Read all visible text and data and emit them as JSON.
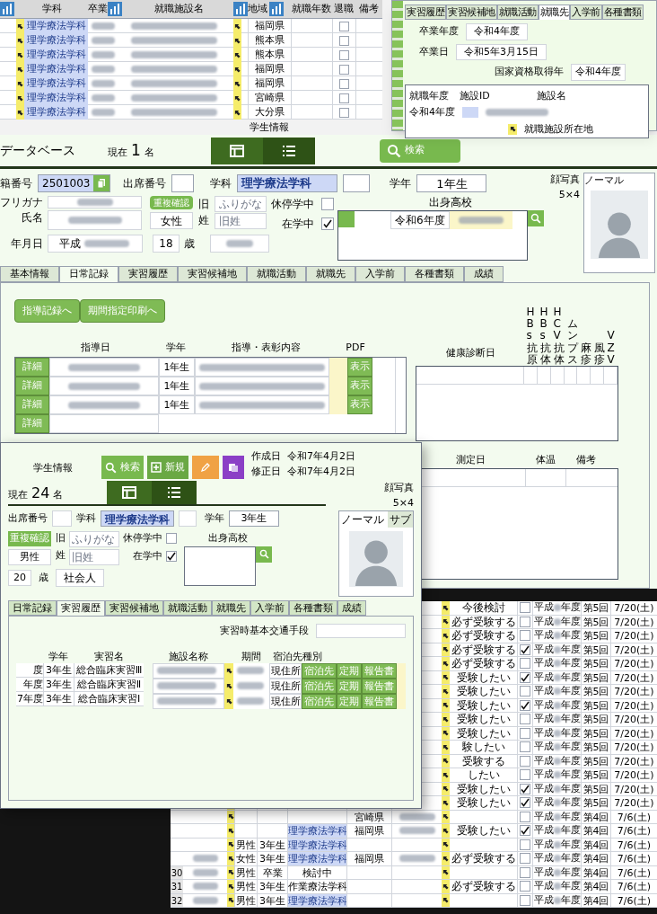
{
  "employment_table": {
    "columns": [
      "学科",
      "卒業",
      "就職施設名",
      "地域",
      "就職年数",
      "退職",
      "備考"
    ],
    "rows": [
      {
        "department": "理学療法学科",
        "region": "福岡県",
        "retired": false
      },
      {
        "department": "理学療法学科",
        "region": "熊本県",
        "retired": false
      },
      {
        "department": "理学療法学科",
        "region": "熊本県",
        "retired": false
      },
      {
        "department": "理学療法学科",
        "region": "福岡県",
        "retired": false
      },
      {
        "department": "理学療法学科",
        "region": "福岡県",
        "retired": false
      },
      {
        "department": "理学療法学科",
        "region": "宮崎県",
        "retired": false
      },
      {
        "department": "理学療法学科",
        "region": "大分県",
        "retired": false
      }
    ]
  },
  "employment_window": {
    "tabs": [
      {
        "label": "実習履歴",
        "selected": false
      },
      {
        "label": "実習候補地",
        "selected": false
      },
      {
        "label": "就職活動",
        "selected": false
      },
      {
        "label": "就職先",
        "selected": true
      },
      {
        "label": "入学前",
        "selected": false
      },
      {
        "label": "各種書類",
        "selected": false
      }
    ],
    "graduation_year_label": "卒業年度",
    "graduation_year": "令和4年度",
    "graduation_date_label": "卒業日",
    "graduation_date": "令和5年3月15日",
    "license_year_label": "国家資格取得年",
    "license_year": "令和4年度",
    "columns": [
      "就職年度",
      "施設ID",
      "施設名",
      "就職施設所在地"
    ],
    "row_year": "令和4年度"
  },
  "header": {
    "title": "学生情報",
    "app_name": "データベース",
    "count_prefix": "現在",
    "count": "1",
    "count_suffix": "名",
    "search_button": "検索"
  },
  "student": {
    "id_label": "籍番号",
    "id": "2501003",
    "attendance_label": "出席番号",
    "department_label": "学科",
    "department": "理学療法学科",
    "grade_label": "学年",
    "grade": "1年生",
    "school_label": "出身高校",
    "school_year": "令和6年度",
    "furigana_label": "フリガナ",
    "name_label": "氏名",
    "duplicate_button": "重複確認",
    "gender": "女性",
    "old_name_label_1": "旧",
    "old_name_label_2": "姓",
    "old_furigana_placeholder": "ふりがな",
    "old_name_placeholder": "旧姓",
    "suspended_label": "休停学中",
    "suspended": false,
    "enrolled_label": "在学中",
    "enrolled": true,
    "birth_label": "年月日",
    "birth_era": "平成",
    "age": "18",
    "age_unit": "歳",
    "photo_label": "顔写真",
    "photo_size": "5×4",
    "photo_tab": "ノーマル"
  },
  "tabs": [
    {
      "label": "基本情報",
      "selected": false
    },
    {
      "label": "日常記録",
      "selected": true
    },
    {
      "label": "実習履歴",
      "selected": false
    },
    {
      "label": "実習候補地",
      "selected": false
    },
    {
      "label": "就職活動",
      "selected": false
    },
    {
      "label": "就職先",
      "selected": false
    },
    {
      "label": "入学前",
      "selected": false
    },
    {
      "label": "各種書類",
      "selected": false
    },
    {
      "label": "成績",
      "selected": false
    }
  ],
  "actions": [
    "指導記録へ",
    "期間指定印刷へ"
  ],
  "guidance_table": {
    "columns": [
      "指導日",
      "学年",
      "指導・表彰内容",
      "PDF"
    ],
    "rows": [
      {
        "detail": "詳細",
        "grade": "1年生",
        "pdf": "表示",
        "filled": true
      },
      {
        "detail": "詳細",
        "grade": "1年生",
        "pdf": "表示",
        "filled": true
      },
      {
        "detail": "詳細",
        "grade": "1年生",
        "pdf": "表示",
        "filled": true
      },
      {
        "detail": "詳細",
        "filled": false
      }
    ]
  },
  "health_table": {
    "columns": [
      "健康診断日",
      "HBs抗原",
      "HBs抗体",
      "HCV抗体",
      "ムンプス",
      "麻疹",
      "風疹",
      "VZV"
    ]
  },
  "temperature_table": {
    "columns": [
      "測定日",
      "体温",
      "備考"
    ]
  },
  "exam_table": {
    "rows": [
      {
        "intent": "今後検討",
        "checked": false,
        "era": "平成",
        "year_suffix": "年度",
        "round": "第5回",
        "date": "7/20(土)"
      },
      {
        "intent": "必ず受験する",
        "checked": false,
        "era": "平成",
        "year_suffix": "年度",
        "round": "第5回",
        "date": "7/20(土)"
      },
      {
        "intent": "必ず受験する",
        "checked": false,
        "era": "平成",
        "year_suffix": "年度",
        "round": "第5回",
        "date": "7/20(土)"
      },
      {
        "intent": "必ず受験する",
        "checked": true,
        "era": "平成",
        "year_suffix": "年度",
        "round": "第5回",
        "date": "7/20(土)"
      },
      {
        "intent": "必ず受験する",
        "checked": false,
        "era": "平成",
        "year_suffix": "年度",
        "round": "第5回",
        "date": "7/20(土)"
      },
      {
        "intent": "受験したい",
        "checked": true,
        "era": "平成",
        "year_suffix": "年度",
        "round": "第5回",
        "date": "7/20(土)"
      },
      {
        "intent": "受験したい",
        "checked": false,
        "era": "平成",
        "year_suffix": "年度",
        "round": "第5回",
        "date": "7/20(土)"
      },
      {
        "intent": "受験したい",
        "checked": true,
        "era": "平成",
        "year_suffix": "年度",
        "round": "第5回",
        "date": "7/20(土)"
      },
      {
        "intent": "受験したい",
        "checked": false,
        "era": "平成",
        "year_suffix": "年度",
        "round": "第5回",
        "date": "7/20(土)"
      },
      {
        "intent": "受験したい",
        "checked": false,
        "era": "平成",
        "year_suffix": "年度",
        "round": "第5回",
        "date": "7/20(土)"
      },
      {
        "intent": "験したい",
        "checked": false,
        "era": "平成",
        "year_suffix": "年度",
        "round": "第5回",
        "date": "7/20(土)"
      },
      {
        "intent": "受験する",
        "checked": false,
        "era": "平成",
        "year_suffix": "年度",
        "round": "第5回",
        "date": "7/20(土)"
      },
      {
        "intent": "したい",
        "checked": false,
        "era": "平成",
        "year_suffix": "年度",
        "round": "第5回",
        "date": "7/20(土)"
      },
      {
        "intent": "受験したい",
        "checked": true,
        "era": "平成",
        "year_suffix": "年度",
        "round": "第5回",
        "date": "7/20(土)"
      },
      {
        "intent": "受験したい",
        "checked": true,
        "era": "平成",
        "year_suffix": "年度",
        "round": "第5回",
        "date": "7/20(土)"
      },
      {
        "region": "宮崎県",
        "school": true,
        "checked": false,
        "era": "平成",
        "year_suffix": "年度",
        "round": "第4回",
        "date": "7/6(土)"
      },
      {
        "department": "理学療法学科",
        "department_highlight": true,
        "region": "福岡県",
        "school": true,
        "intent": "受験したい",
        "checked": true,
        "era": "平成",
        "year_suffix": "年度",
        "round": "第4回",
        "date": "7/6(土)"
      },
      {
        "gender": "男性",
        "grade": "3年生",
        "department": "理学療法学科",
        "department_highlight": true,
        "checked": false,
        "era": "平成",
        "year_suffix": "年度",
        "round": "第4回",
        "date": "7/6(土)"
      },
      {
        "name": true,
        "gender": "女性",
        "grade": "3年生",
        "department": "理学療法学科",
        "department_highlight": true,
        "region": "福岡県",
        "school": true,
        "intent": "必ず受験する",
        "checked": false,
        "era": "平成",
        "year_suffix": "年度",
        "round": "第4回",
        "date": "7/6(土)"
      },
      {
        "number": "30",
        "name": true,
        "gender": "男性",
        "grade": "卒業",
        "department": "検討中",
        "department_highlight": false,
        "checked": false,
        "era": "平成",
        "year_suffix": "年度",
        "round": "第4回",
        "date": "7/6(土)"
      },
      {
        "number": "31",
        "name": true,
        "gender": "男性",
        "grade": "3年生",
        "department": "作業療法学科",
        "department_highlight": false,
        "intent": "必ず受験する",
        "checked": false,
        "era": "平成",
        "year_suffix": "年度",
        "round": "第4回",
        "date": "7/6(土)"
      },
      {
        "number": "32",
        "name": true,
        "gender": "男性",
        "grade": "3年生",
        "department": "理学療法学科",
        "department_highlight": true,
        "checked": false,
        "era": "平成",
        "year_suffix": "年度",
        "round": "第4回",
        "date": "7/6(土)"
      }
    ]
  },
  "overlay_window": {
    "title": "学生情報",
    "count_prefix": "現在",
    "count": "24",
    "count_suffix": "名",
    "search_button": "検索",
    "new_button": "新規",
    "created_label": "作成日",
    "created": "令和7年4月2日",
    "modified_label": "修正日",
    "modified": "令和7年4月2日",
    "attendance_label": "出席番号",
    "department_label": "学科",
    "department": "理学療法学科",
    "grade_label": "学年",
    "grade": "3年生",
    "school_label": "出身高校",
    "photo_label": "顔写真",
    "photo_size": "5×4",
    "photo_tabs": [
      {
        "label": "ノーマル",
        "selected": true
      },
      {
        "label": "サブ",
        "selected": false
      }
    ],
    "duplicate_button": "重複確認",
    "gender": "男性",
    "old_name_label_1": "旧",
    "old_name_label_2": "姓",
    "old_furigana_placeholder": "ふりがな",
    "old_name_placeholder": "旧姓",
    "suspended_label": "休停学中",
    "suspended": false,
    "enrolled_label": "在学中",
    "enrolled": true,
    "age": "20",
    "age_unit": "歳",
    "occupation": "社会人",
    "tabs": [
      {
        "label": "日常記録",
        "selected": false
      },
      {
        "label": "実習履歴",
        "selected": true
      },
      {
        "label": "実習候補地",
        "selected": false
      },
      {
        "label": "就職活動",
        "selected": false
      },
      {
        "label": "就職先",
        "selected": false
      },
      {
        "label": "入学前",
        "selected": false
      },
      {
        "label": "各種書類",
        "selected": false
      },
      {
        "label": "成績",
        "selected": false
      }
    ],
    "transport_label": "実習時基本交通手段",
    "practice_columns": [
      "学年",
      "実習名"
    ],
    "practice_rows": [
      {
        "year": "度",
        "grade": "3年生",
        "name": "総合臨床実習Ⅲ"
      },
      {
        "year": "年度",
        "grade": "3年生",
        "name": "総合臨床実習Ⅱ"
      },
      {
        "year": "7年度",
        "grade": "3年生",
        "name": "総合臨床実習Ⅰ"
      }
    ],
    "facility_label": "施設名称",
    "period_label": "期間",
    "lodging_label": "宿泊先種別",
    "facility_rows": [
      {
        "lodging": "現住所",
        "buttons": [
          "宿泊先",
          "定期",
          "報告書"
        ]
      },
      {
        "lodging": "現住所",
        "buttons": [
          "宿泊先",
          "定期",
          "報告書"
        ]
      },
      {
        "lodging": "現住所",
        "buttons": [
          "宿泊先",
          "定期",
          "報告書"
        ]
      }
    ]
  }
}
